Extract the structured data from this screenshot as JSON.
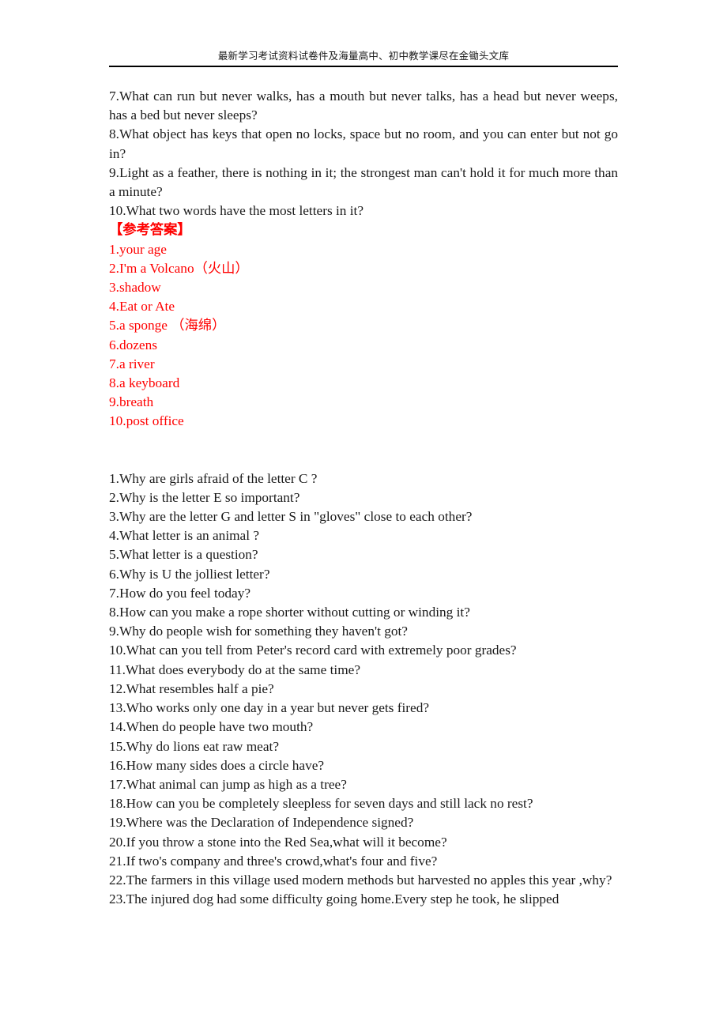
{
  "header": {
    "watermark_text": "最新学习考试资料试卷件及海量高中、初中教学课尽在金锄头文库"
  },
  "colors": {
    "answer_red": "#ff0000",
    "body_text": "#1a1a1a",
    "page_background": "#ffffff"
  },
  "section_one": {
    "questions": [
      "7.What can run but never walks, has a mouth but never talks, has a head but never weeps, has a bed but never sleeps?",
      "8.What object has keys that open no locks, space but no room, and you can enter but not go in?",
      "9.Light as a feather, there is nothing in it; the strongest man can't hold it for much more than a minute?",
      "10.What two words have the most letters in it?"
    ]
  },
  "answers": {
    "title": "【参考答案】",
    "items": [
      "1.your age",
      "2.I'm a Volcano（火山）",
      "3.shadow",
      "4.Eat or Ate",
      "5.a sponge （海绵）",
      "6.dozens",
      "7.a river",
      "8.a keyboard",
      "9.breath",
      "10.post office"
    ]
  },
  "section_two": {
    "questions": [
      "1.Why are girls afraid of the letter C ?",
      "2.Why is the letter E so important?",
      "3.Why are the letter G and letter S in \"gloves\" close to each other?",
      "4.What letter is an animal ?",
      "5.What letter is a question?",
      "6.Why is U the jolliest letter?",
      "7.How do you feel today?",
      "8.How can you make a rope shorter without cutting or winding it?",
      "9.Why do people wish for something they haven't got?",
      "10.What can you tell from Peter's record card with extremely poor grades?",
      "11.What does everybody do at the same time?",
      "12.What resembles half a pie?",
      "13.Who works only one day in a year but never gets fired?",
      "14.When do people have two mouth?",
      "15.Why do lions eat raw meat?",
      "16.How many sides does a circle have?",
      "17.What animal can jump as high as a tree?",
      "18.How can you be completely sleepless for seven days and still lack no rest?",
      "19.Where was the Declaration of Independence signed?",
      "20.If you throw a stone into the Red Sea,what will it become?",
      "21.If two's company and three's crowd,what's four and five?",
      "22.The farmers in this village used modern methods but harvested no apples this year ,why?",
      "23.The injured dog had some difficulty going home.Every step he took, he slipped"
    ]
  }
}
